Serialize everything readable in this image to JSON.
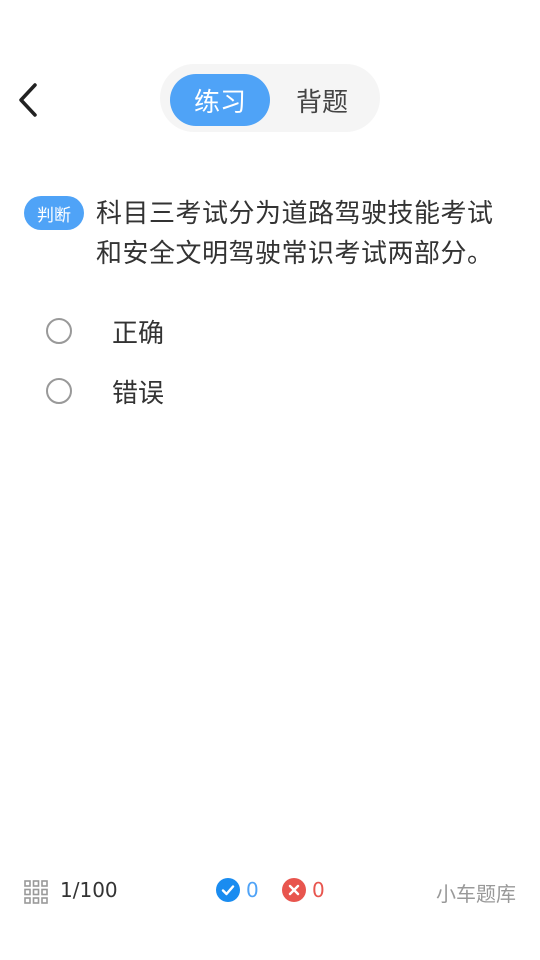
{
  "header": {
    "tabs": [
      {
        "label": "练习",
        "active": true
      },
      {
        "label": "背题",
        "active": false
      }
    ],
    "back_icon": "chevron-left-icon"
  },
  "question": {
    "type_badge": "判断",
    "text": "科目三考试分为道路驾驶技能考试和安全文明驾驶常识考试两部分。",
    "options": [
      {
        "label": "正确"
      },
      {
        "label": "错误"
      }
    ]
  },
  "footer": {
    "grid_icon": "grid-icon",
    "progress": "1/100",
    "correct_count": "0",
    "wrong_count": "0",
    "brand": "小车题库"
  },
  "colors": {
    "accent": "#4fa3f7",
    "correct": "#1a8cf0",
    "wrong": "#e8554e"
  }
}
